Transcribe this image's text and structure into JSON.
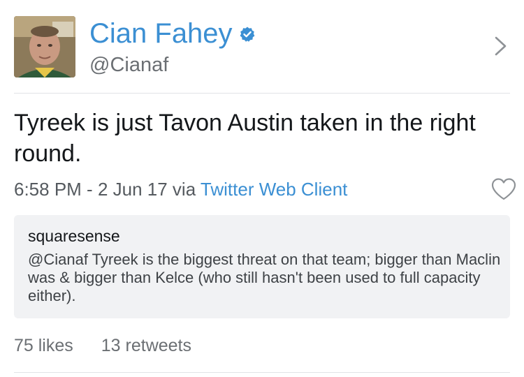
{
  "profile": {
    "display_name": "Cian Fahey",
    "handle": "@Cianaf",
    "verified": true,
    "avatar_icon": "profile-photo"
  },
  "tweet": {
    "text": "Tyreek is just Tavon Austin taken in the right round.",
    "time": "6:58 PM",
    "separator": " - ",
    "date": "2 Jun 17",
    "via": " via ",
    "client": "Twitter Web Client"
  },
  "quoted_tweet": {
    "username": "squaresense",
    "text": "@Cianaf Tyreek is the biggest threat on that team; bigger than Maclin was & bigger than Kelce (who still hasn't been used to full capacity either)."
  },
  "stats": {
    "likes": "75 likes",
    "retweets": "13 retweets"
  },
  "colors": {
    "accent": "#3b8fd3",
    "text": "#14171a",
    "secondary": "#6b6f73",
    "quote_bg": "#f1f2f4"
  }
}
